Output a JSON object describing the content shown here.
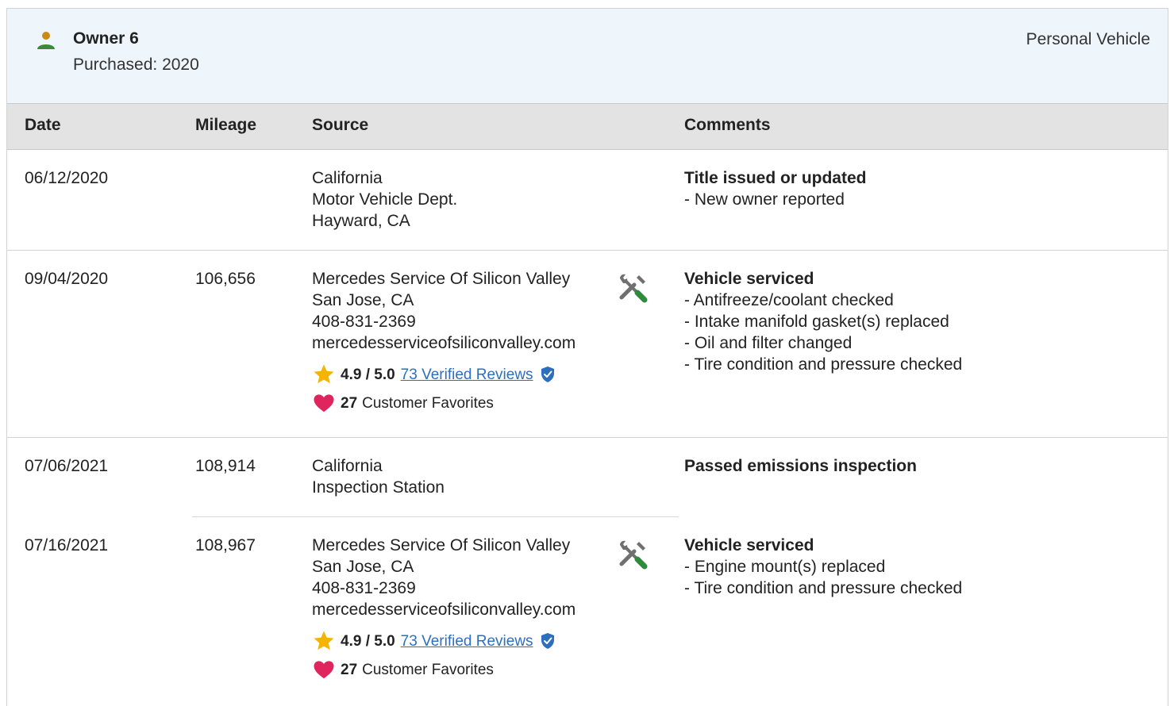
{
  "owner": {
    "name": "Owner 6",
    "purchased": "Purchased: 2020",
    "vehicle_type": "Personal Vehicle",
    "icon": "person-icon",
    "icon_color": "#3a8a3a",
    "icon_head_color": "#c98a1a"
  },
  "columns": {
    "date": "Date",
    "mileage": "Mileage",
    "source": "Source",
    "comments": "Comments"
  },
  "records": [
    {
      "date": "06/12/2020",
      "mileage": "",
      "source": [
        "California",
        "Motor Vehicle Dept.",
        "Hayward, CA"
      ],
      "comment_title": "Title issued or updated",
      "comment_items": [
        "- New owner reported"
      ]
    },
    {
      "date": "09/04/2020",
      "mileage": "106,656",
      "source": [
        "Mercedes Service Of Silicon Valley",
        "San Jose, CA",
        "408-831-2369",
        "mercedesserviceofsiliconvalley.com"
      ],
      "rating": "4.9 / 5.0",
      "reviews": "73 Verified Reviews",
      "favorites_count": "27",
      "favorites_label": "Customer Favorites",
      "comment_title": "Vehicle serviced",
      "comment_items": [
        "- Antifreeze/coolant checked",
        "- Intake manifold gasket(s) replaced",
        "- Oil and filter changed",
        "- Tire condition and pressure checked"
      ]
    },
    {
      "date": "07/06/2021",
      "mileage": "108,914",
      "source": [
        "California",
        "Inspection Station"
      ],
      "comment_title": "Passed emissions inspection",
      "comment_items": []
    },
    {
      "date": "07/16/2021",
      "mileage": "108,967",
      "source": [
        "Mercedes Service Of Silicon Valley",
        "San Jose, CA",
        "408-831-2369",
        "mercedesserviceofsiliconvalley.com"
      ],
      "rating": "4.9 / 5.0",
      "reviews": "73 Verified Reviews",
      "favorites_count": "27",
      "favorites_label": "Customer Favorites",
      "comment_title": "Vehicle serviced",
      "comment_items": [
        "- Engine mount(s) replaced",
        "- Tire condition and pressure checked"
      ]
    }
  ],
  "colors": {
    "header_bg": "#eef5fb",
    "table_head_bg": "#e3e3e3",
    "link": "#2b6fbe",
    "star": "#f5b400",
    "heart": "#e0245e",
    "tools_gray": "#707070",
    "tools_green": "#2e8b3e",
    "verified": "#2b6fbe"
  }
}
